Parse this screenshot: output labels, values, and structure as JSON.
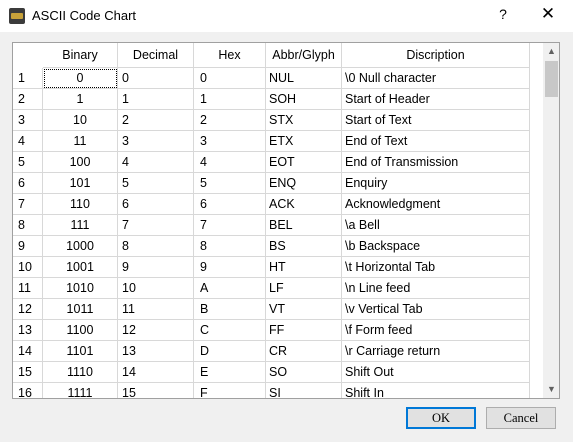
{
  "window": {
    "title": "ASCII Code Chart",
    "help_label": "?",
    "close_label": "✕",
    "app_icon": "terminal-app-icon"
  },
  "table": {
    "headers": {
      "binary": "Binary",
      "decimal": "Decimal",
      "hex": "Hex",
      "abbr": "Abbr/Glyph",
      "description": "Discription"
    },
    "rows": [
      {
        "num": "1",
        "binary": "0",
        "decimal": "0",
        "hex": "0",
        "abbr": "NUL",
        "desc": "\\0 Null character"
      },
      {
        "num": "2",
        "binary": "1",
        "decimal": "1",
        "hex": "1",
        "abbr": "SOH",
        "desc": "Start of Header"
      },
      {
        "num": "3",
        "binary": "10",
        "decimal": "2",
        "hex": "2",
        "abbr": "STX",
        "desc": "Start of Text"
      },
      {
        "num": "4",
        "binary": "11",
        "decimal": "3",
        "hex": "3",
        "abbr": "ETX",
        "desc": "End of Text"
      },
      {
        "num": "5",
        "binary": "100",
        "decimal": "4",
        "hex": "4",
        "abbr": "EOT",
        "desc": "End of Transmission"
      },
      {
        "num": "6",
        "binary": "101",
        "decimal": "5",
        "hex": "5",
        "abbr": "ENQ",
        "desc": "Enquiry"
      },
      {
        "num": "7",
        "binary": "110",
        "decimal": "6",
        "hex": "6",
        "abbr": "ACK",
        "desc": "Acknowledgment"
      },
      {
        "num": "8",
        "binary": "111",
        "decimal": "7",
        "hex": "7",
        "abbr": "BEL",
        "desc": "\\a Bell"
      },
      {
        "num": "9",
        "binary": "1000",
        "decimal": "8",
        "hex": "8",
        "abbr": "BS",
        "desc": "\\b Backspace"
      },
      {
        "num": "10",
        "binary": "1001",
        "decimal": "9",
        "hex": "9",
        "abbr": "HT",
        "desc": "\\t Horizontal Tab"
      },
      {
        "num": "11",
        "binary": "1010",
        "decimal": "10",
        "hex": "A",
        "abbr": "LF",
        "desc": "\\n Line feed"
      },
      {
        "num": "12",
        "binary": "1011",
        "decimal": "11",
        "hex": "B",
        "abbr": "VT",
        "desc": "\\v Vertical Tab"
      },
      {
        "num": "13",
        "binary": "1100",
        "decimal": "12",
        "hex": "C",
        "abbr": "FF",
        "desc": "\\f Form feed"
      },
      {
        "num": "14",
        "binary": "1101",
        "decimal": "13",
        "hex": "D",
        "abbr": "CR",
        "desc": "\\r Carriage return"
      },
      {
        "num": "15",
        "binary": "1110",
        "decimal": "14",
        "hex": "E",
        "abbr": "SO",
        "desc": "Shift Out"
      },
      {
        "num": "16",
        "binary": "1111",
        "decimal": "15",
        "hex": "F",
        "abbr": "SI",
        "desc": "Shift In"
      }
    ]
  },
  "buttons": {
    "ok": "OK",
    "cancel": "Cancel"
  },
  "colors": {
    "accent": "#0078d7",
    "grid": "#d8d8d8"
  }
}
